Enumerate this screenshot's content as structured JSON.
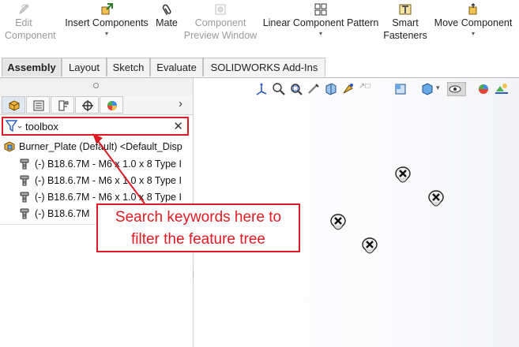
{
  "ribbon": {
    "buttons": [
      {
        "id": "edit-component",
        "label": "Edit\nComponent",
        "disabled": true,
        "icon": "edit-component-icon"
      },
      {
        "id": "insert-components",
        "label": "Insert Components",
        "disabled": false,
        "icon": "insert-components-icon",
        "has_dropdown": true
      },
      {
        "id": "mate",
        "label": "Mate",
        "disabled": false,
        "icon": "mate-paperclip-icon"
      },
      {
        "id": "component-preview-window",
        "label": "Component\nPreview Window",
        "disabled": true,
        "icon": "preview-window-icon"
      },
      {
        "id": "linear-component-pattern",
        "label": "Linear Component Pattern",
        "disabled": false,
        "icon": "linear-pattern-icon",
        "has_dropdown": true
      },
      {
        "id": "smart-fasteners",
        "label": "Smart\nFasteners",
        "disabled": false,
        "icon": "smart-fasteners-icon"
      },
      {
        "id": "move-component",
        "label": "Move Component",
        "disabled": false,
        "icon": "move-component-icon",
        "has_dropdown": true
      }
    ]
  },
  "tabs": [
    {
      "label": "Assembly",
      "active": true
    },
    {
      "label": "Layout",
      "active": false
    },
    {
      "label": "Sketch",
      "active": false
    },
    {
      "label": "Evaluate",
      "active": false
    },
    {
      "label": "SOLIDWORKS Add-Ins",
      "active": false
    }
  ],
  "manager_tabs": [
    {
      "icon": "featuremanager-tree-icon",
      "active": true
    },
    {
      "icon": "propertymanager-icon",
      "active": false
    },
    {
      "icon": "configurationmanager-icon",
      "active": false
    },
    {
      "icon": "dimxpertmanager-icon",
      "active": false
    },
    {
      "icon": "displaymanager-icon",
      "active": false
    }
  ],
  "filter": {
    "value": "toolbox",
    "icon": "filter-funnel-icon",
    "clear_icon": "clear-x-icon"
  },
  "tree": {
    "root": {
      "label": "Burner_Plate (Default) <Default_Disp",
      "icon": "assembly-icon"
    },
    "items": [
      {
        "label": "(-) B18.6.7M - M6 x 1.0 x 8 Type I",
        "icon": "toolbox-screw-icon"
      },
      {
        "label": "(-) B18.6.7M - M6 x 1.0 x 8 Type I",
        "icon": "toolbox-screw-icon"
      },
      {
        "label": "(-) B18.6.7M - M6 x 1.0 x 8 Type I",
        "icon": "toolbox-screw-icon"
      },
      {
        "label": "(-) B18.6.7M",
        "icon": "toolbox-screw-icon"
      }
    ]
  },
  "callout": {
    "line1": "Search keywords here to",
    "line2": "filter the feature tree",
    "color": "#e01a22"
  },
  "colors": {
    "accent_red": "#e01a22",
    "active_tab_bg": "#e6e6e6"
  }
}
